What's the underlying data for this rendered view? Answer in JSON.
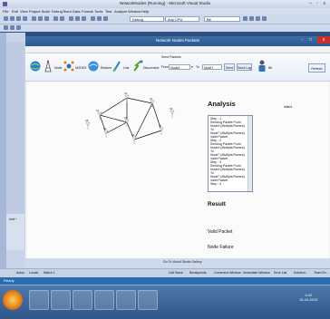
{
  "vs": {
    "title": "NetworkNodes (Running) - Microsoft Visual Studio",
    "menu": [
      "File",
      "Edit",
      "View",
      "Project",
      "Build",
      "Debug",
      "Team",
      "Data",
      "Format",
      "Tools",
      "Test",
      "Analyze",
      "Window",
      "Help"
    ],
    "toolbar": {
      "config_value": "Debug",
      "platform_value": "Any CPU",
      "search_value": "Bit"
    },
    "left_tab_label": "Add+",
    "output_label": "Go To Visual Studio Gallery",
    "bottom_tabs": [
      "Autos",
      "Locals",
      "Watch 1",
      "Call Stack",
      "Breakpoints",
      "Command Window",
      "Immediate Window",
      "Error List",
      "Solution...",
      "Team Ex..."
    ],
    "status": "Ready"
  },
  "app": {
    "title": "Network Nodes Packets",
    "toolbar": {
      "node_label": "Node",
      "nodes_label": "NODES",
      "restore_label": "Restore",
      "link_label": "Link",
      "disconnect_label": "Disconnect",
      "send_packets_label": "Send Packets",
      "from_label": "From",
      "from_value": "Node4",
      "to_label": "To",
      "to_value": "Node7",
      "send_label": "Send",
      "send_log_label": "Send Log",
      "bit_label": "Bit",
      "refresh_label": "Refresh"
    },
    "network": {
      "nodes": [
        "N1",
        "N2",
        "N3",
        "N4",
        "N5",
        "N6",
        "N7",
        "N8",
        "N9"
      ]
    },
    "analysis": {
      "heading": "Analysis",
      "label": "label1",
      "log": [
        "Step : 1",
        "Sending Packet From Node4 (Multiple/Towers) To",
        "Node7 (Multiple/Towers)",
        "Valid Packet",
        "Step : 2",
        "Sending Packet From Node4 (Multiple/Towers) To",
        "Node7 (Multiple/Towers)",
        "Valid Packet",
        "Step : 3",
        "Sending Packet From Node4 (Multiple/Towers) To",
        "Node7 (Multiple/Towers)",
        "Valid Packet",
        "Step : 4"
      ],
      "result_heading": "Result",
      "valid_packet": "Valid Packet",
      "node_failure": "Node Failure"
    },
    "window_buttons": {
      "min": "-",
      "max": "□",
      "close": "x"
    }
  },
  "taskbar": {
    "time": "4:42",
    "date": "16-10-2015"
  },
  "colors": {
    "vs_chrome": "#cfd9ec",
    "app_titlebar": "#2b5a91",
    "close_button": "#c9302c",
    "taskbar": "#2f5589"
  }
}
